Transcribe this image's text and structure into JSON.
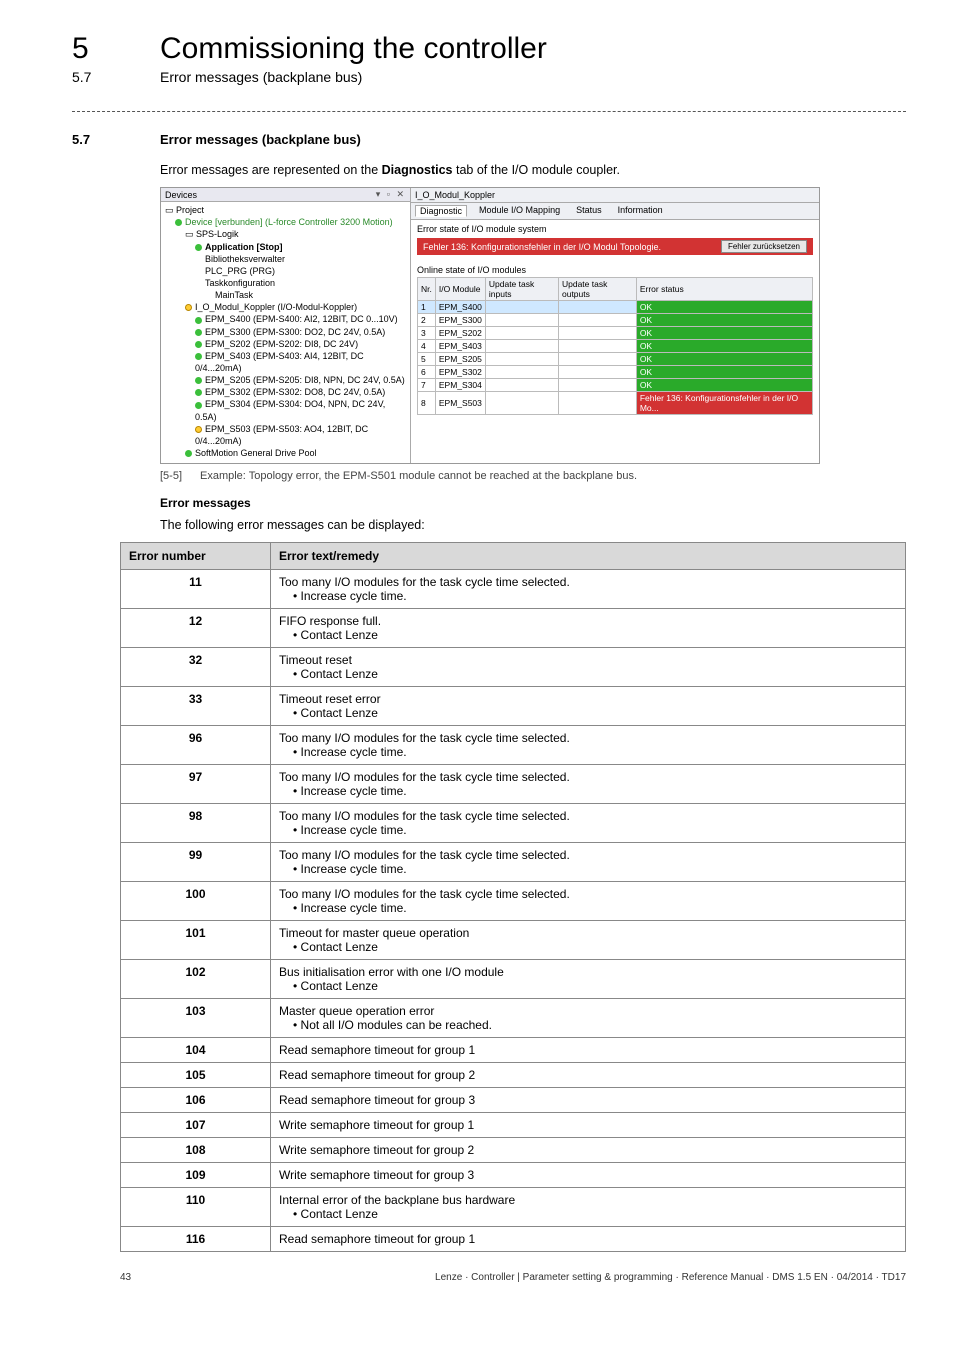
{
  "header": {
    "chapter_num": "5",
    "chapter_title": "Commissioning the controller",
    "sub_num": "5.7",
    "sub_title": "Error messages (backplane bus)"
  },
  "section": {
    "num": "5.7",
    "title": "Error messages (backplane bus)",
    "intro_pre": "Error messages are represented on the ",
    "intro_bold": "Diagnostics",
    "intro_post": " tab of the I/O module coupler."
  },
  "screenshot": {
    "devices_title": "Devices",
    "devices_pin": "▾  ▫  ✕",
    "tree": {
      "project": "Project",
      "device": "Device [verbunden] (L-force Controller 3200 Motion)",
      "sps": "SPS-Logik",
      "app": "Application [Stop]",
      "lib": "Bibliotheksverwalter",
      "plc": "PLC_PRG (PRG)",
      "task": "Taskkonfiguration",
      "maintask": "MainTask",
      "koppler": "I_O_Modul_Koppler (I/O-Modul-Koppler)",
      "mods": [
        "EPM_S400 (EPM-S400: AI2, 12BIT, DC 0...10V)",
        "EPM_S300 (EPM-S300: DO2, DC 24V, 0.5A)",
        "EPM_S202 (EPM-S202: DI8, DC 24V)",
        "EPM_S403 (EPM-S403: AI4, 12BIT, DC 0/4...20mA)",
        "EPM_S205 (EPM-S205: DI8, NPN, DC 24V, 0.5A)",
        "EPM_S302 (EPM-S302: DO8, DC 24V, 0.5A)",
        "EPM_S304 (EPM-S304: DO4, NPN, DC 24V, 0.5A)",
        "EPM_S503 (EPM-S503: AO4, 12BIT, DC 0/4...20mA)"
      ],
      "softmotion": "SoftMotion General Drive Pool"
    },
    "right_title_tab": "I_O_Modul_Koppler",
    "tabs": [
      "Diagnostic",
      "Module I/O Mapping",
      "Status",
      "Information"
    ],
    "err_state_label": "Error state of I/O module system",
    "err_banner": "Fehler 136: Konfigurationsfehler in der I/O Modul Topologie.",
    "reset_btn": "Fehler zurücksetzen",
    "online_label": "Online state of I/O modules",
    "cols": [
      "Nr.",
      "I/O Module",
      "Update task inputs",
      "Update task outputs",
      "Error status"
    ],
    "rows": [
      {
        "nr": "1",
        "mod": "EPM_S400",
        "status": "OK",
        "hl": true
      },
      {
        "nr": "2",
        "mod": "EPM_S300",
        "status": "OK"
      },
      {
        "nr": "3",
        "mod": "EPM_S202",
        "status": "OK"
      },
      {
        "nr": "4",
        "mod": "EPM_S403",
        "status": "OK"
      },
      {
        "nr": "5",
        "mod": "EPM_S205",
        "status": "OK"
      },
      {
        "nr": "6",
        "mod": "EPM_S302",
        "status": "OK"
      },
      {
        "nr": "7",
        "mod": "EPM_S304",
        "status": "OK"
      },
      {
        "nr": "8",
        "mod": "EPM_S503",
        "status": "Fehler 136: Konfigurationsfehler in der I/O Mo...",
        "bad": true
      }
    ]
  },
  "caption": {
    "num": "[5-5]",
    "text": "Example: Topology error, the EPM-S501 module cannot be reached at the backplane bus."
  },
  "errors": {
    "heading": "Error messages",
    "lead": "The following error messages can be displayed:",
    "col1": "Error number",
    "col2": "Error text/remedy",
    "rows": [
      {
        "n": "11",
        "t": "Too many I/O modules for the task cycle time selected.",
        "b": "• Increase cycle time."
      },
      {
        "n": "12",
        "t": "FIFO response full.",
        "b": "• Contact Lenze"
      },
      {
        "n": "32",
        "t": "Timeout reset",
        "b": "• Contact Lenze"
      },
      {
        "n": "33",
        "t": "Timeout reset error",
        "b": "• Contact Lenze"
      },
      {
        "n": "96",
        "t": "Too many I/O modules for the task cycle time selected.",
        "b": "• Increase cycle time."
      },
      {
        "n": "97",
        "t": "Too many I/O modules for the task cycle time selected.",
        "b": "• Increase cycle time."
      },
      {
        "n": "98",
        "t": "Too many I/O modules for the task cycle time selected.",
        "b": "• Increase cycle time."
      },
      {
        "n": "99",
        "t": "Too many I/O modules for the task cycle time selected.",
        "b": "• Increase cycle time."
      },
      {
        "n": "100",
        "t": "Too many I/O modules for the task cycle time selected.",
        "b": "• Increase cycle time."
      },
      {
        "n": "101",
        "t": "Timeout for master queue operation",
        "b": "• Contact Lenze"
      },
      {
        "n": "102",
        "t": "Bus initialisation error with one I/O module",
        "b": "• Contact Lenze"
      },
      {
        "n": "103",
        "t": "Master queue operation error",
        "b": "• Not all I/O modules can be reached."
      },
      {
        "n": "104",
        "t": "Read semaphore timeout for group 1"
      },
      {
        "n": "105",
        "t": "Read semaphore timeout for group 2"
      },
      {
        "n": "106",
        "t": "Read semaphore timeout for group 3"
      },
      {
        "n": "107",
        "t": "Write semaphore timeout for group 1"
      },
      {
        "n": "108",
        "t": "Write semaphore timeout for group 2"
      },
      {
        "n": "109",
        "t": "Write semaphore timeout for group 3"
      },
      {
        "n": "110",
        "t": "Internal error of the backplane bus hardware",
        "b": "• Contact Lenze"
      },
      {
        "n": "116",
        "t": "Read semaphore timeout for group 1"
      }
    ]
  },
  "footer": {
    "page": "43",
    "right": "Lenze · Controller | Parameter setting & programming · Reference Manual · DMS 1.5 EN · 04/2014 · TD17"
  }
}
